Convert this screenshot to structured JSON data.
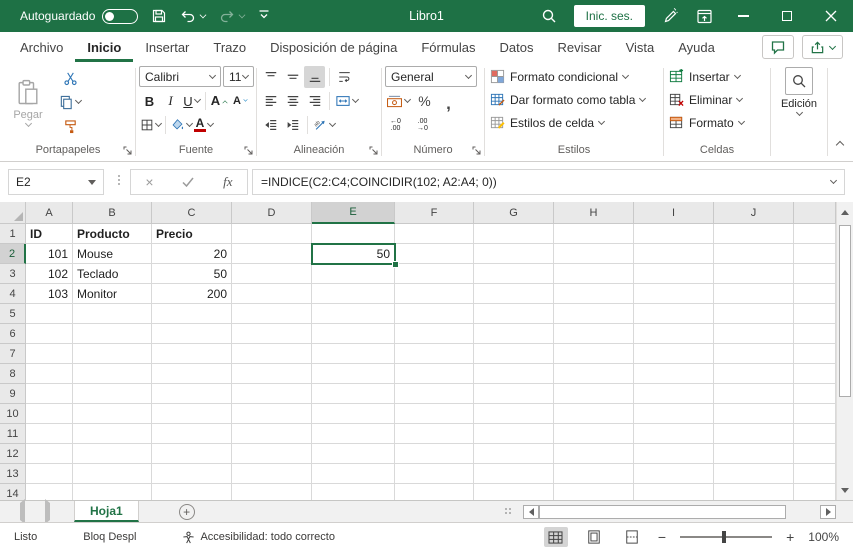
{
  "window": {
    "autosave_label": "Autoguardado",
    "document_title": "Libro1",
    "signin_label": "Inic. ses."
  },
  "tabs": {
    "items": [
      {
        "label": "Archivo",
        "active": false
      },
      {
        "label": "Inicio",
        "active": true
      },
      {
        "label": "Insertar",
        "active": false
      },
      {
        "label": "Trazo",
        "active": false
      },
      {
        "label": "Disposición de página",
        "active": false
      },
      {
        "label": "Fórmulas",
        "active": false
      },
      {
        "label": "Datos",
        "active": false
      },
      {
        "label": "Revisar",
        "active": false
      },
      {
        "label": "Vista",
        "active": false
      },
      {
        "label": "Ayuda",
        "active": false
      }
    ]
  },
  "ribbon": {
    "clipboard": {
      "paste": "Pegar",
      "label": "Portapapeles"
    },
    "font": {
      "family": "Calibri",
      "size": "11",
      "bold": "B",
      "italic": "I",
      "underline": "U",
      "grow": "A",
      "shrink": "A",
      "color": "A",
      "label": "Fuente"
    },
    "alignment": {
      "label": "Alineación"
    },
    "number": {
      "format": "General",
      "percent": "%",
      "comma": ",",
      "inc_top": "←0",
      "inc_bottom": ".00",
      "dec_top": ".00",
      "dec_bottom": "→0",
      "label": "Número"
    },
    "styles": {
      "buttons": [
        "Formato condicional",
        "Dar formato como tabla",
        "Estilos de celda"
      ],
      "label": "Estilos"
    },
    "cells": {
      "buttons": [
        "Insertar",
        "Eliminar",
        "Formato"
      ],
      "label": "Celdas"
    },
    "editing": {
      "label": "Edición"
    }
  },
  "formula_bar": {
    "name_box": "E2",
    "fx_label": "fx",
    "formula": "=INDICE(C2:C4;COINCIDIR(102; A2:A4; 0))"
  },
  "grid": {
    "columns": [
      "A",
      "B",
      "C",
      "D",
      "E",
      "F",
      "G",
      "H",
      "I",
      "J"
    ],
    "row_labels": [
      "1",
      "2",
      "3",
      "4",
      "5",
      "6",
      "7",
      "8",
      "9",
      "10",
      "11",
      "12",
      "13",
      "14"
    ],
    "selected_column": "E",
    "selected_row": "2",
    "selected_cell": "E2",
    "cells": [
      {
        "ref": "A1",
        "value": "ID",
        "bold": true,
        "align": "left"
      },
      {
        "ref": "B1",
        "value": "Producto",
        "bold": true,
        "align": "left"
      },
      {
        "ref": "C1",
        "value": "Precio",
        "bold": true,
        "align": "left"
      },
      {
        "ref": "A2",
        "value": "101",
        "align": "right"
      },
      {
        "ref": "B2",
        "value": "Mouse",
        "align": "left"
      },
      {
        "ref": "C2",
        "value": "20",
        "align": "right"
      },
      {
        "ref": "E2",
        "value": "50",
        "align": "right"
      },
      {
        "ref": "A3",
        "value": "102",
        "align": "right"
      },
      {
        "ref": "B3",
        "value": "Teclado",
        "align": "left"
      },
      {
        "ref": "C3",
        "value": "50",
        "align": "right"
      },
      {
        "ref": "A4",
        "value": "103",
        "align": "right"
      },
      {
        "ref": "B4",
        "value": "Monitor",
        "align": "left"
      },
      {
        "ref": "C4",
        "value": "200",
        "align": "right"
      }
    ]
  },
  "sheet_bar": {
    "sheet_name": "Hoja1"
  },
  "status_bar": {
    "mode": "Listo",
    "scroll_lock": "Bloq Despl",
    "accessibility": "Accesibilidad: todo correcto",
    "zoom_level": "100%"
  },
  "colors": {
    "titlebar_green": "#1E7145",
    "accent_green": "#217346"
  }
}
